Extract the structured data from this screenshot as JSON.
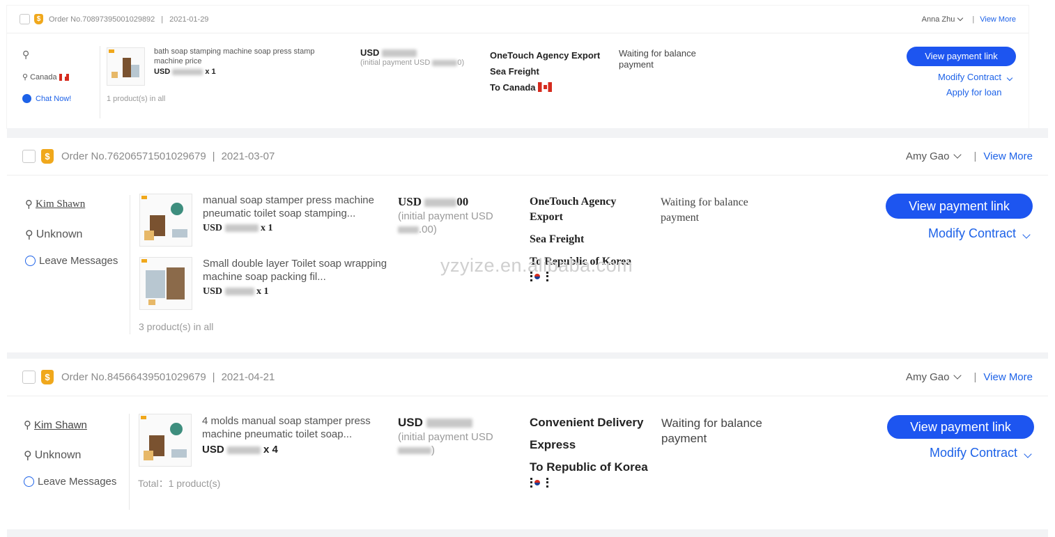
{
  "orders": [
    {
      "badge": "$",
      "order_no": "Order No.70897395001029892",
      "date": "2021-01-29",
      "agent": "Anna Zhu",
      "view_more": "View More",
      "buyer_location": "Canada",
      "buyer_contact": "Chat Now!",
      "products": [
        {
          "title": "bath soap stamping machine soap press stamp machine price",
          "price_prefix": "USD",
          "qty": "x 1"
        }
      ],
      "product_count": "1 product(s) in all",
      "amount_prefix": "USD",
      "initial_payment": "(initial payment USD",
      "initial_payment_tail": "0)",
      "shipping_method": "OneTouch Agency Export",
      "freight": "Sea Freight",
      "destination": "To Canada",
      "status": "Waiting for balance payment",
      "action_primary": "View payment link",
      "action_modify": "Modify Contract",
      "action_loan": "Apply for loan"
    },
    {
      "badge": "$",
      "order_no": "Order No.76206571501029679",
      "date": "2021-03-07",
      "agent": "Amy Gao",
      "view_more": "View More",
      "buyer_name": "Kim Shawn",
      "buyer_location": "Unknown",
      "buyer_contact": "Leave Messages",
      "products": [
        {
          "title": "manual soap stamper press machine pneumatic toilet soap stamping...",
          "price_prefix": "USD",
          "qty": "x 1"
        },
        {
          "title": "Small double layer Toilet soap wrapping machine soap packing fil...",
          "price_prefix": "USD",
          "qty": "x 1"
        }
      ],
      "product_count": "3 product(s) in all",
      "amount_prefix": "USD",
      "amount_tail": "00",
      "initial_payment": "(initial payment USD",
      "initial_payment_tail": ".00)",
      "shipping_method": "OneTouch Agency Export",
      "freight": "Sea Freight",
      "destination": "To Republic of Korea",
      "status": "Waiting for balance payment",
      "action_primary": "View payment link",
      "action_modify": "Modify Contract"
    },
    {
      "badge": "$",
      "order_no": "Order No.84566439501029679",
      "date": "2021-04-21",
      "agent": "Amy Gao",
      "view_more": "View More",
      "buyer_name": "Kim Shawn",
      "buyer_location": "Unknown",
      "buyer_contact": "Leave Messages",
      "products": [
        {
          "title": "4 molds manual soap stamper press machine pneumatic toilet soap...",
          "price_prefix": "USD",
          "qty": "x 4"
        }
      ],
      "product_count": "Total：1 product(s)",
      "amount_prefix": "USD",
      "initial_payment": "(initial payment USD",
      "initial_payment_tail": ")",
      "shipping_method": "Convenient Delivery",
      "freight": "Express",
      "destination": "To Republic of Korea",
      "status": "Waiting for balance payment",
      "action_primary": "View payment link",
      "action_modify": "Modify Contract"
    }
  ],
  "watermark": "yzyize.en.alibaba.com",
  "colors": {
    "accent": "#1d55f0",
    "link": "#1d62e8",
    "badge": "#f0a81c"
  }
}
